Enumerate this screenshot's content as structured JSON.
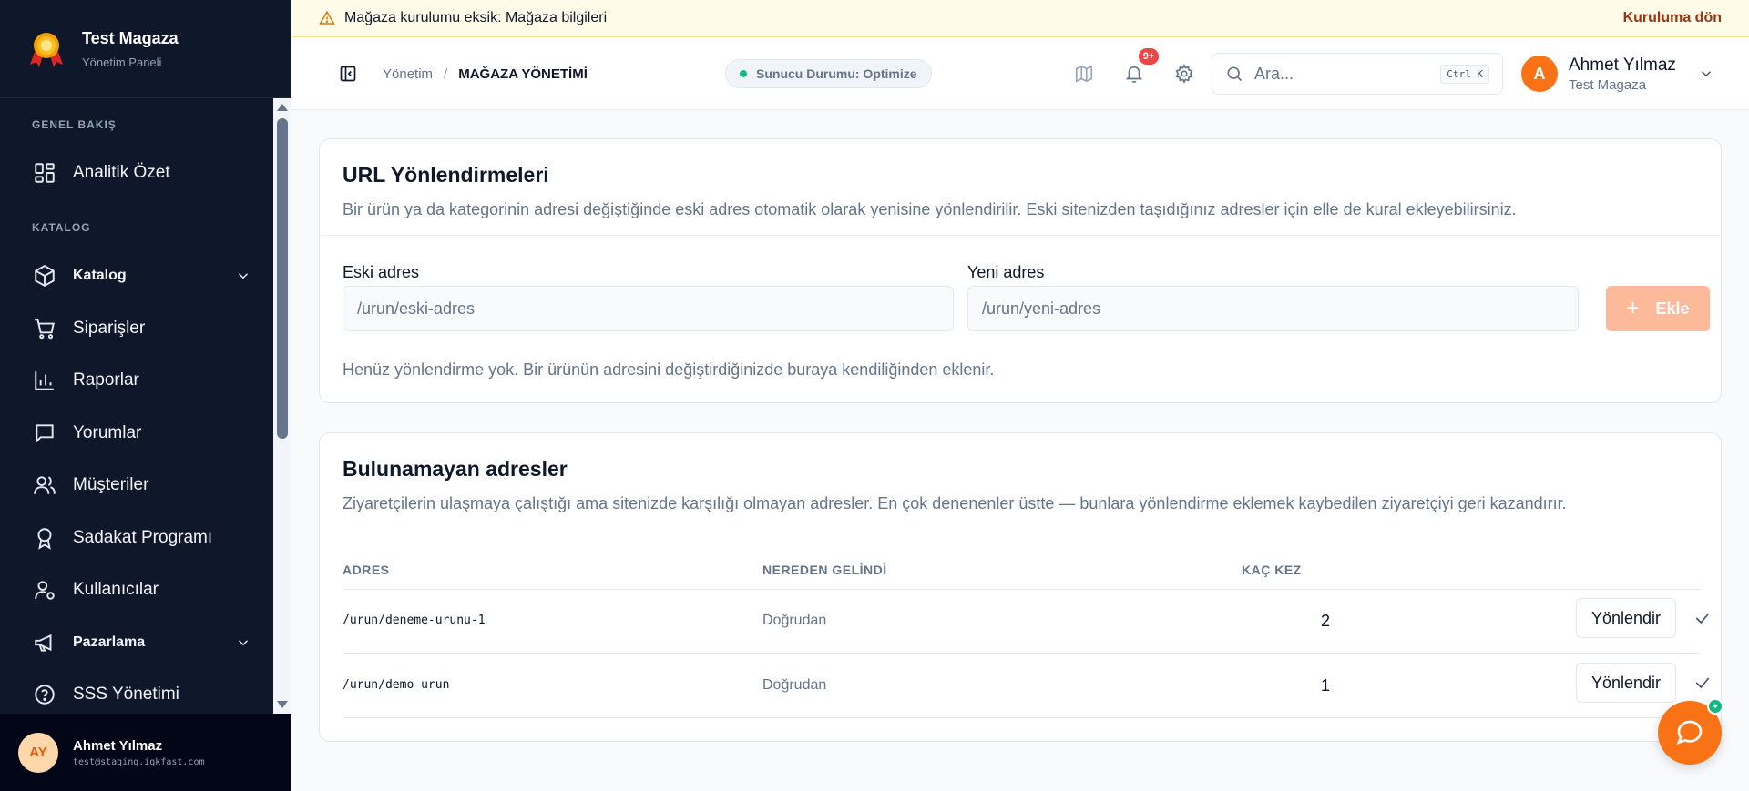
{
  "brand": {
    "title": "Test Magaza",
    "subtitle": "Yönetim Paneli"
  },
  "sidebar": {
    "sections": [
      {
        "label": "GENEL BAKIŞ"
      },
      {
        "label": "KATALOG"
      }
    ],
    "items": [
      {
        "label": "Analitik Özet",
        "icon": "dashboard-icon"
      },
      {
        "label": "Katalog",
        "icon": "box-icon"
      },
      {
        "label": "Siparişler",
        "icon": "cart-icon"
      },
      {
        "label": "Raporlar",
        "icon": "bar-chart-icon"
      },
      {
        "label": "Yorumlar",
        "icon": "message-icon"
      },
      {
        "label": "Müşteriler",
        "icon": "users-icon"
      },
      {
        "label": "Sadakat Programı",
        "icon": "award-icon"
      },
      {
        "label": "Kullanıcılar",
        "icon": "user-cog-icon"
      },
      {
        "label": "Pazarlama",
        "icon": "megaphone-icon"
      },
      {
        "label": "SSS Yönetimi",
        "icon": "help-circle-icon"
      }
    ],
    "user": {
      "initials": "AY",
      "name": "Ahmet Yılmaz",
      "email": "test@staging.igkfast.com"
    }
  },
  "banner": {
    "prefix": "Mağaza kurulumu eksik:",
    "link": "Mağaza bilgileri",
    "action": "Kuruluma dön"
  },
  "topbar": {
    "breadcrumb": {
      "first": "Yönetim",
      "separator": "/",
      "current": "MAĞAZA YÖNETİMİ"
    },
    "status": "Sunucu Durumu: Optimize",
    "notifications_badge": "9+",
    "search": {
      "placeholder": "Ara...",
      "shortcut": "Ctrl K"
    },
    "user": {
      "initial": "A",
      "name": "Ahmet Yılmaz",
      "store": "Test Magaza"
    }
  },
  "redirects": {
    "title": "URL Yönlendirmeleri",
    "description": "Bir ürün ya da kategorinin adresi değiştiğinde eski adres otomatik olarak yenisine yönlendirilir. Eski sitenizden taşıdığınız adresler için elle de kural ekleyebilirsiniz.",
    "old_label": "Eski adres",
    "old_placeholder": "/urun/eski-adres",
    "new_label": "Yeni adres",
    "new_placeholder": "/urun/yeni-adres",
    "add_label": "Ekle",
    "empty": "Henüz yönlendirme yok. Bir ürünün adresini değiştirdiğinizde buraya kendiliğinden eklenir."
  },
  "not_found": {
    "title": "Bulunamayan adresler",
    "description": "Ziyaretçilerin ulaşmaya çalıştığı ama sitenizde karşılığı olmayan adresler. En çok denenenler üstte — bunlara yönlendirme eklemek kaybedilen ziyaretçiyi geri kazandırır.",
    "columns": {
      "address": "ADRES",
      "source": "NEREDEN GELİNDİ",
      "count": "KAÇ KEZ"
    },
    "rows": [
      {
        "address": "/urun/deneme-urunu-1",
        "source": "Doğrudan",
        "count": "2",
        "action": "Yönlendir"
      },
      {
        "address": "/urun/demo-urun",
        "source": "Doğrudan",
        "count": "1",
        "action": "Yönlendir"
      }
    ]
  },
  "colors": {
    "accent": "#f97316",
    "sidebar": "#0f172a",
    "success": "#10b981",
    "danger": "#ef4444"
  }
}
